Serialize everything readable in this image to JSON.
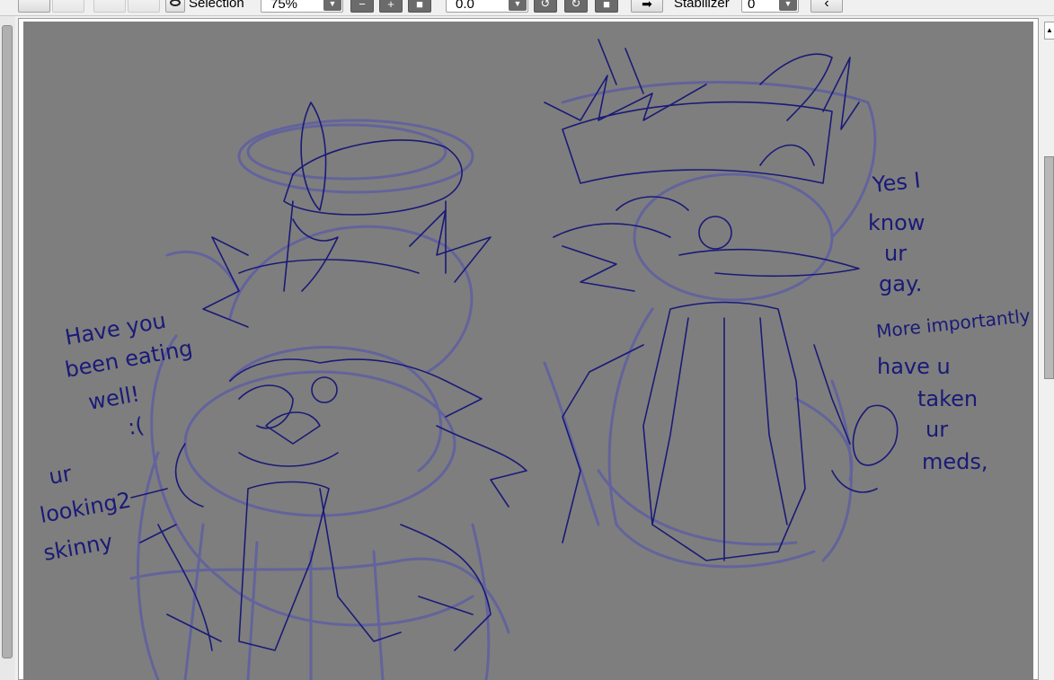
{
  "toolbar": {
    "selection_label": "Selection",
    "zoom_value": "75%",
    "zoom_out_symbol": "−",
    "zoom_in_symbol": "+",
    "zoom_reset_symbol": "■",
    "rotation_value": "0.0",
    "rotate_left_symbol": "↺",
    "rotate_right_symbol": "↻",
    "rotate_reset_symbol": "■",
    "flip_symbol": "➡",
    "stabilizer_label": "Stabilizer",
    "stabilizer_value": "0",
    "dropdown_arrow": "▼",
    "nav_back_symbol": "‹"
  },
  "scrollbar": {
    "up_symbol": "▲"
  },
  "canvas": {
    "background_color": "#7e7e7e",
    "line_color": "#1a1a78",
    "sketch_color": "#5a5aa6",
    "notes_left": [
      "Have you",
      "been eating",
      "well!",
      ":(",
      "ur",
      "looking2",
      "skinny"
    ],
    "notes_right": [
      "Yes I",
      "know",
      "ur",
      "gay.",
      "More importantly",
      "have u",
      "taken",
      "ur",
      "meds,"
    ]
  }
}
